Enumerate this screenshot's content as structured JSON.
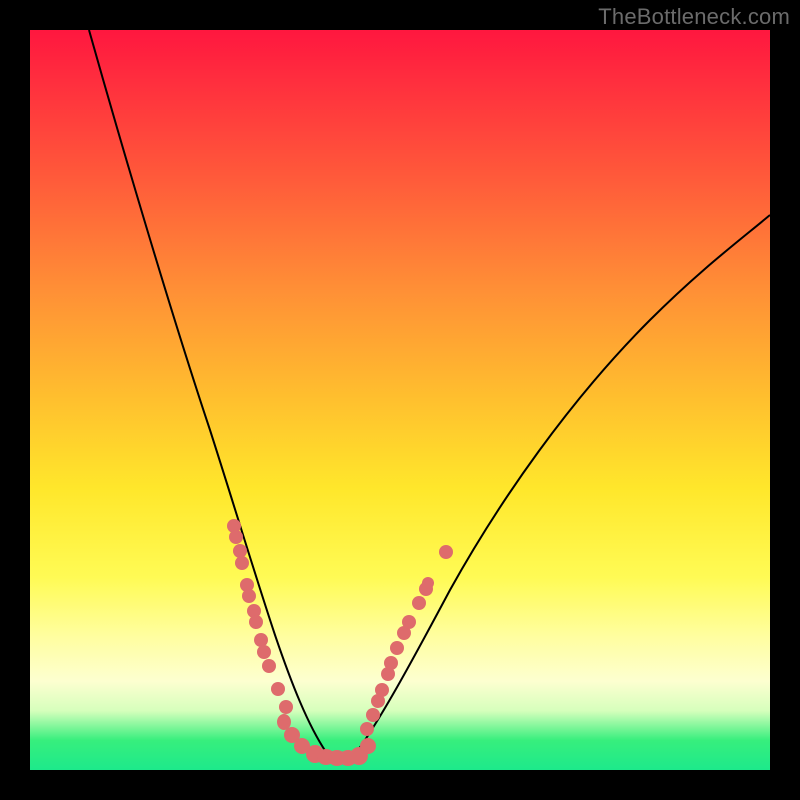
{
  "watermark": "TheBottleneck.com",
  "colors": {
    "frame": "#000000",
    "gradient_top": "#ff173f",
    "gradient_mid": "#ffe72b",
    "gradient_bottom": "#1de98b",
    "curve": "#000000",
    "dots": "#de6b6c"
  },
  "chart_data": {
    "type": "line",
    "title": "",
    "xlabel": "",
    "ylabel": "",
    "xlim": [
      0,
      100
    ],
    "ylim": [
      0,
      100
    ],
    "series": [
      {
        "name": "left-curve",
        "x": [
          8,
          10,
          12,
          14,
          16,
          18,
          20,
          22,
          24,
          26,
          27.5,
          29,
          30.5,
          32,
          33,
          34,
          35,
          36,
          37,
          38,
          39,
          40
        ],
        "y": [
          100,
          92,
          84,
          77,
          70,
          63,
          56,
          49,
          43,
          37,
          33,
          29,
          25.5,
          22,
          19,
          16,
          13,
          10,
          7.5,
          5,
          3,
          2
        ]
      },
      {
        "name": "right-curve",
        "x": [
          44,
          45,
          46,
          47,
          48.5,
          50,
          52,
          55,
          58,
          62,
          66,
          70,
          75,
          80,
          86,
          92,
          100
        ],
        "y": [
          2,
          4,
          6.5,
          9,
          12,
          15.5,
          20,
          26,
          31,
          37.5,
          43,
          48,
          53.5,
          58.5,
          64,
          69,
          75
        ]
      }
    ],
    "scatter": [
      {
        "name": "dots-left",
        "points": [
          [
            27.5,
            33
          ],
          [
            27.5,
            31.5
          ],
          [
            28.2,
            29.5
          ],
          [
            28.5,
            28
          ],
          [
            29.3,
            25
          ],
          [
            29.5,
            23.5
          ],
          [
            30.2,
            21.5
          ],
          [
            30.5,
            20
          ],
          [
            31.2,
            17.5
          ],
          [
            31.6,
            16
          ],
          [
            32.3,
            14
          ],
          [
            33.5,
            11
          ],
          [
            34.5,
            8.5
          ],
          [
            35.5,
            6.5
          ],
          [
            37,
            5
          ],
          [
            38.5,
            3.5
          ]
        ]
      },
      {
        "name": "dots-right",
        "points": [
          [
            45.5,
            5.5
          ],
          [
            46.3,
            7.5
          ],
          [
            47,
            9.3
          ],
          [
            47.5,
            10.8
          ],
          [
            48.3,
            13
          ],
          [
            48.8,
            14.5
          ],
          [
            49.5,
            16.5
          ],
          [
            50.5,
            18.5
          ],
          [
            51.2,
            20
          ],
          [
            52.5,
            22.5
          ],
          [
            53.5,
            24.5
          ],
          [
            53.8,
            25.2
          ],
          [
            56.2,
            29.5
          ]
        ]
      }
    ],
    "bottom_cluster": {
      "x_range": [
        38,
        46
      ],
      "y_range": [
        1.5,
        4
      ]
    }
  }
}
